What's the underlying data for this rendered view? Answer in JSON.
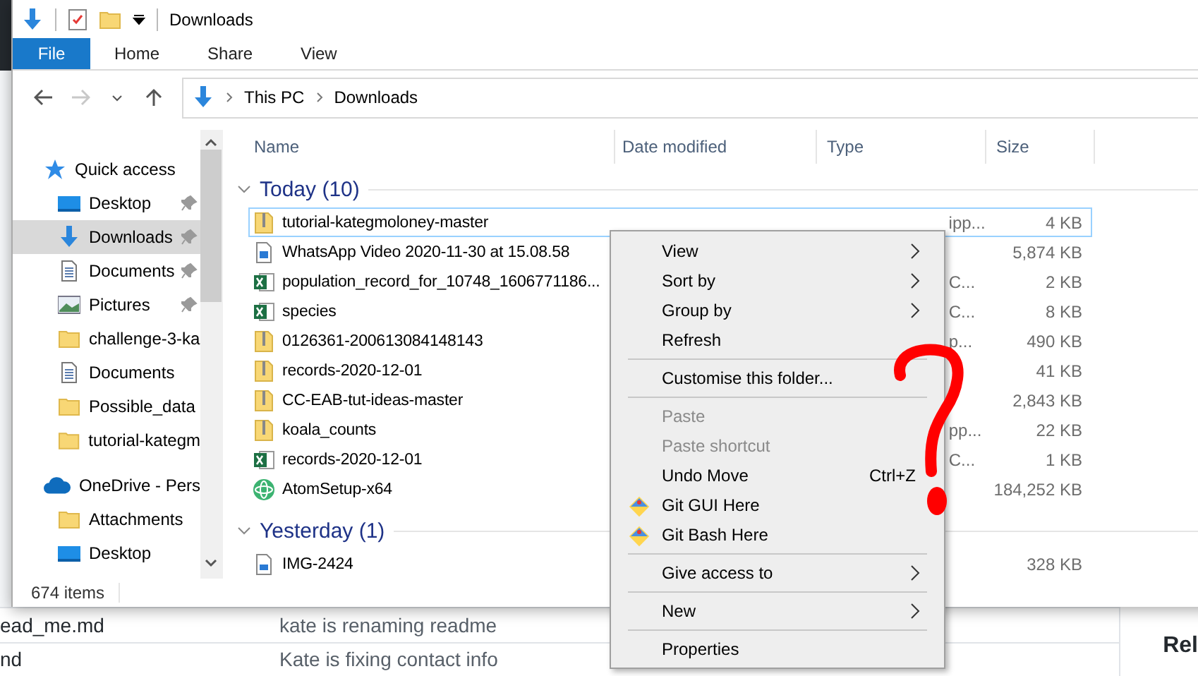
{
  "background_page": {
    "rows": [
      {
        "file": "ead_me.md",
        "message": "kate is renaming readme"
      },
      {
        "file": "nd",
        "message": "Kate is fixing contact info"
      }
    ],
    "side_heading": "Rel"
  },
  "window": {
    "title": "Downloads",
    "ribbon_tabs": [
      {
        "label": "File",
        "selected": true
      },
      {
        "label": "Home",
        "selected": false
      },
      {
        "label": "Share",
        "selected": false
      },
      {
        "label": "View",
        "selected": false
      }
    ],
    "forward_disabled": true,
    "address": [
      "This PC",
      "Downloads"
    ],
    "sidebar": [
      {
        "label": "Quick access",
        "kind": "star",
        "selected": false,
        "children": [
          {
            "label": "Desktop",
            "kind": "desktop",
            "pinned": true,
            "selected": false
          },
          {
            "label": "Downloads",
            "kind": "download",
            "pinned": true,
            "selected": true
          },
          {
            "label": "Documents",
            "kind": "document",
            "pinned": true,
            "selected": false
          },
          {
            "label": "Pictures",
            "kind": "pictures",
            "pinned": true,
            "selected": false
          },
          {
            "label": "challenge-3-ka",
            "kind": "folder",
            "pinned": false,
            "selected": false
          },
          {
            "label": "Documents",
            "kind": "document",
            "pinned": false,
            "selected": false
          },
          {
            "label": "Possible_data",
            "kind": "folder",
            "pinned": false,
            "selected": false
          },
          {
            "label": "tutorial-kategm",
            "kind": "folder",
            "pinned": false,
            "selected": false
          }
        ]
      },
      {
        "label": "OneDrive - Pers",
        "kind": "cloud",
        "selected": false,
        "children": [
          {
            "label": "Attachments",
            "kind": "folder",
            "pinned": false,
            "selected": false
          },
          {
            "label": "Desktop",
            "kind": "desktop",
            "pinned": false,
            "selected": false
          }
        ]
      }
    ],
    "columns": [
      "Name",
      "Date modified",
      "Type",
      "Size"
    ],
    "groups": [
      {
        "label": "Today (10)",
        "expanded": true,
        "files": [
          {
            "name": "tutorial-kategmoloney-master",
            "kind": "zip",
            "selected": true,
            "type": "ipp...",
            "size": "4 KB"
          },
          {
            "name": "WhatsApp Video 2020-11-30 at 15.08.58",
            "kind": "video",
            "selected": false,
            "size": "5,874 KB"
          },
          {
            "name": "population_record_for_10748_1606771186...",
            "kind": "excel",
            "selected": false,
            "type": "C...",
            "size": "2 KB"
          },
          {
            "name": "species",
            "kind": "excel",
            "selected": false,
            "type": "C...",
            "size": "8 KB"
          },
          {
            "name": "0126361-200613084148143",
            "kind": "zip",
            "selected": false,
            "type": "p...",
            "size": "490 KB"
          },
          {
            "name": "records-2020-12-01",
            "kind": "zip",
            "selected": false,
            "size": "41 KB"
          },
          {
            "name": "CC-EAB-tut-ideas-master",
            "kind": "zip",
            "selected": false,
            "size": "2,843 KB"
          },
          {
            "name": "koala_counts",
            "kind": "zip",
            "selected": false,
            "type": "pp...",
            "size": "22 KB"
          },
          {
            "name": "records-2020-12-01",
            "kind": "excel",
            "selected": false,
            "type": "C...",
            "size": "1 KB"
          },
          {
            "name": "AtomSetup-x64",
            "kind": "app",
            "selected": false,
            "size": "184,252 KB"
          }
        ]
      },
      {
        "label": "Yesterday (1)",
        "expanded": true,
        "files": [
          {
            "name": "IMG-2424",
            "kind": "image",
            "selected": false,
            "size": "328 KB"
          }
        ]
      }
    ],
    "status_bar": "674 items"
  },
  "context_menu": [
    {
      "kind": "submenu",
      "label": "View",
      "disabled": false
    },
    {
      "kind": "submenu",
      "label": "Sort by",
      "disabled": false
    },
    {
      "kind": "submenu",
      "label": "Group by",
      "disabled": false
    },
    {
      "kind": "item",
      "label": "Refresh",
      "disabled": false
    },
    {
      "kind": "separator"
    },
    {
      "kind": "item",
      "label": "Customise this folder...",
      "disabled": false
    },
    {
      "kind": "separator"
    },
    {
      "kind": "item",
      "label": "Paste",
      "disabled": true
    },
    {
      "kind": "item",
      "label": "Paste shortcut",
      "disabled": true
    },
    {
      "kind": "item",
      "label": "Undo Move",
      "shortcut": "Ctrl+Z",
      "disabled": false
    },
    {
      "kind": "git_item",
      "label": "Git GUI Here",
      "disabled": false
    },
    {
      "kind": "git_item",
      "label": "Git Bash Here",
      "disabled": false
    },
    {
      "kind": "separator"
    },
    {
      "kind": "submenu",
      "label": "Give access to",
      "disabled": false
    },
    {
      "kind": "separator"
    },
    {
      "kind": "submenu",
      "label": "New",
      "disabled": false
    },
    {
      "kind": "separator"
    },
    {
      "kind": "item",
      "label": "Properties",
      "disabled": false
    }
  ]
}
